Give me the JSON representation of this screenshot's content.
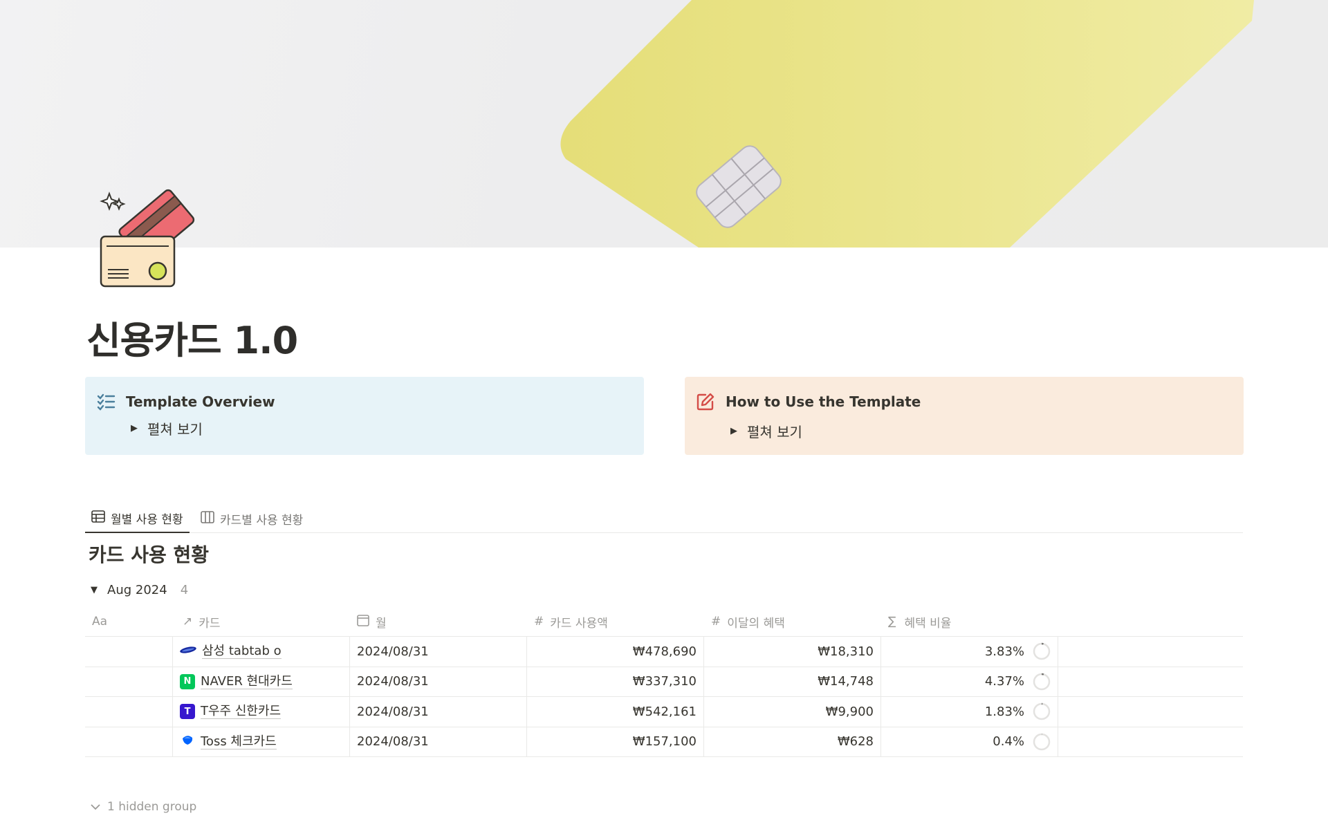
{
  "page": {
    "title": "신용카드 1.0"
  },
  "callouts": [
    {
      "title": "Template Overview",
      "toggle_label": "펼쳐 보기",
      "icon": "checklist-icon",
      "color": "#e7f3f8"
    },
    {
      "title": "How to Use the Template",
      "toggle_label": "펼쳐 보기",
      "icon": "edit-icon",
      "color": "#faebdd"
    }
  ],
  "tabs": [
    {
      "label": "월별 사용 현황",
      "icon": "table-icon",
      "active": true
    },
    {
      "label": "카드별 사용 현황",
      "icon": "board-icon",
      "active": false
    }
  ],
  "database": {
    "title": "카드 사용 현황",
    "group": {
      "label": "Aug 2024",
      "count": "4"
    },
    "columns": [
      {
        "icon": "Aa",
        "label": ""
      },
      {
        "icon": "↗",
        "label": "카드"
      },
      {
        "icon": "calendar-icon",
        "label": "월"
      },
      {
        "icon": "#",
        "label": "카드 사용액"
      },
      {
        "icon": "#",
        "label": "이달의 혜택"
      },
      {
        "icon": "∑",
        "label": "혜택 비율"
      }
    ],
    "rows": [
      {
        "card": "삼성 tabtab o",
        "logo": "samsung-logo-icon",
        "month": "2024/08/31",
        "spend": "₩478,690",
        "benefit": "₩18,310",
        "ratio": "3.83%",
        "ratio_value": 0.0383
      },
      {
        "card": "NAVER 현대카드",
        "logo": "naver-logo-icon",
        "month": "2024/08/31",
        "spend": "₩337,310",
        "benefit": "₩14,748",
        "ratio": "4.37%",
        "ratio_value": 0.0437
      },
      {
        "card": "T우주 신한카드",
        "logo": "t-universe-logo-icon",
        "month": "2024/08/31",
        "spend": "₩542,161",
        "benefit": "₩9,900",
        "ratio": "1.83%",
        "ratio_value": 0.0183
      },
      {
        "card": "Toss 체크카드",
        "logo": "toss-logo-icon",
        "month": "2024/08/31",
        "spend": "₩157,100",
        "benefit": "₩628",
        "ratio": "0.4%",
        "ratio_value": 0.004
      }
    ],
    "hidden_groups": "1 hidden group"
  },
  "colors": {
    "naver": "#03c75a",
    "t_universe": "#3617ce",
    "toss": "#0064ff",
    "samsung": "#1428a0"
  }
}
